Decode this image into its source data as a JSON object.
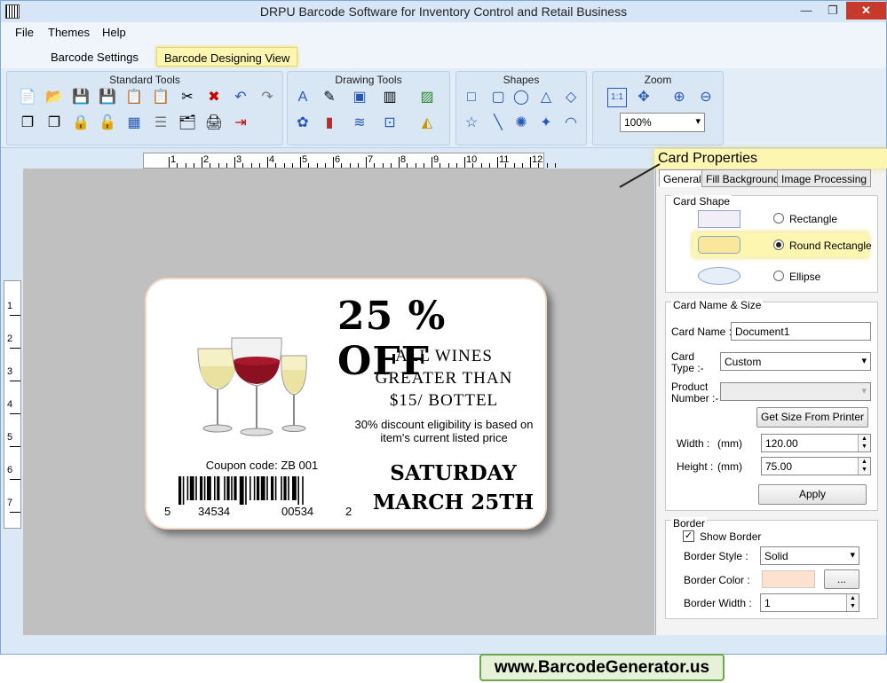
{
  "window": {
    "title": "DRPU Barcode Software for Inventory Control and Retail Business"
  },
  "menu": {
    "file": "File",
    "themes": "Themes",
    "help": "Help"
  },
  "ribbon_tabs": {
    "settings": "Barcode Settings",
    "designing": "Barcode Designing View"
  },
  "ribbon": {
    "standard_tools": "Standard Tools",
    "drawing_tools": "Drawing Tools",
    "shapes": "Shapes",
    "zoom": "Zoom",
    "zoom_value": "100%",
    "zoom_fit": "1:1"
  },
  "ruler": {
    "h": [
      "1",
      "2",
      "3",
      "4",
      "5",
      "6",
      "7",
      "8",
      "9",
      "10",
      "11",
      "12"
    ],
    "v": [
      "1",
      "2",
      "3",
      "4",
      "5",
      "6",
      "7"
    ]
  },
  "card": {
    "headline": "25 % OFF",
    "line1": "ALL WINES",
    "line2": "GREATER THAN",
    "line3": "$15/ BOTTEL",
    "desc1": "30% discount eligibility is based on",
    "desc2": "item's current  listed price",
    "date1": "SATURDAY",
    "date2": "MARCH 25TH",
    "coupon": "Coupon code: ZB 001",
    "bc1": "5",
    "bc2": "34534",
    "bc3": "00534",
    "bc4": "2"
  },
  "properties": {
    "title": "Card Properties",
    "tabs": [
      "General",
      "Fill Background",
      "Image Processing"
    ],
    "card_shape_label": "Card Shape",
    "shapes": [
      "Rectangle",
      "Round Rectangle",
      "Ellipse"
    ],
    "selected_shape": "Round Rectangle",
    "name_size_label": "Card  Name & Size",
    "card_name_label": "Card Name :",
    "card_name_value": "Document1",
    "card_type_label_1": "Card",
    "card_type_label_2": "Type :-",
    "card_type_value": "Custom",
    "product_label_1": "Product",
    "product_label_2": "Number :-",
    "get_size_button": "Get Size From Printer",
    "width_label": "Width :",
    "height_label": "Height :",
    "unit": "(mm)",
    "width_value": "120.00",
    "height_value": "75.00",
    "apply_button": "Apply",
    "border_label": "Border",
    "show_border_label": "Show Border",
    "show_border_checked": true,
    "border_style_label": "Border Style :",
    "border_style_value": "Solid",
    "border_color_label": "Border Color :",
    "border_color": "#fde2cf",
    "border_color_button": "...",
    "border_width_label": "Border Width :",
    "border_width_value": "1"
  },
  "footer": {
    "website": "www.BarcodeGenerator.us"
  }
}
